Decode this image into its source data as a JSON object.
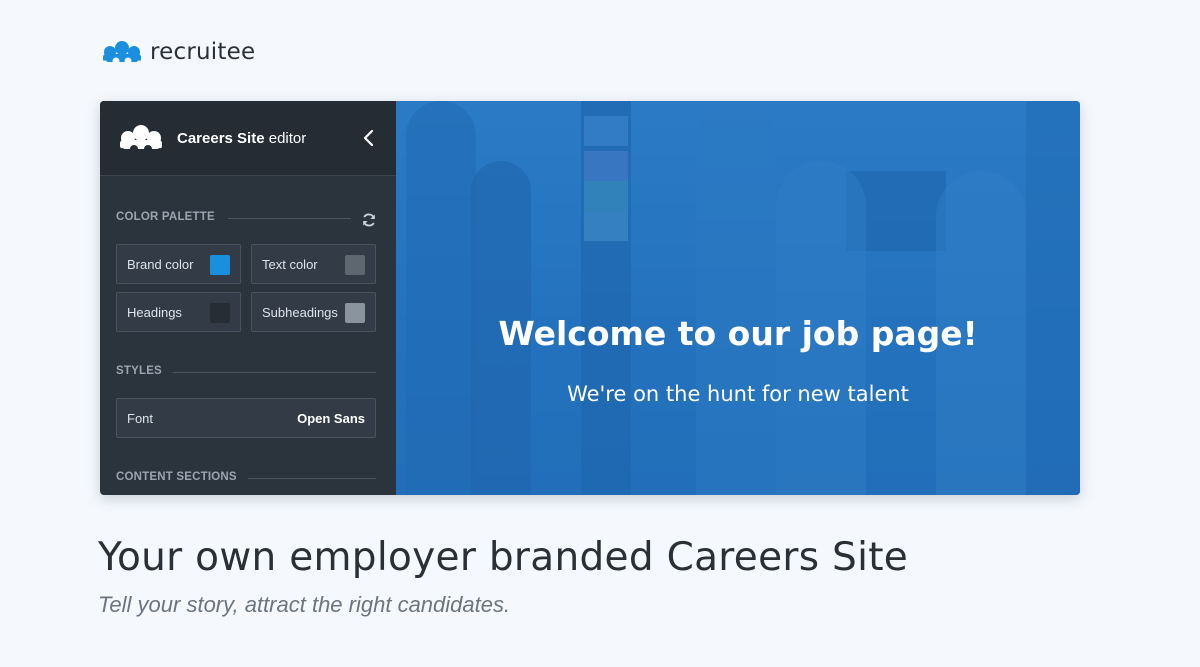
{
  "brand": {
    "name": "recruitee",
    "logo_icon": "recruitee-people-logo-icon",
    "accent": "#1a8fe0"
  },
  "editor": {
    "title_bold": "Careers Site",
    "title_light": "editor",
    "collapse_icon": "chevron-left-icon",
    "color_palette": {
      "label": "COLOR PALETTE",
      "refresh_icon": "refresh-icon",
      "items": [
        {
          "label": "Brand color",
          "color": "#1a8fe0"
        },
        {
          "label": "Text color",
          "color": "#5e6670"
        },
        {
          "label": "Headings",
          "color": "#262d35"
        },
        {
          "label": "Subheadings",
          "color": "#8a949e"
        }
      ]
    },
    "styles": {
      "label": "STYLES",
      "font_label": "Font",
      "font_value": "Open Sans"
    },
    "content_sections": {
      "label": "CONTENT SECTIONS"
    }
  },
  "hero": {
    "title": "Welcome to our job page!",
    "subtitle": "We're on the hunt for new talent",
    "overlay_color": "#1c6ebe"
  },
  "page": {
    "headline": "Your own employer branded Careers Site",
    "subheadline": "Tell your story, attract the right candidates."
  }
}
